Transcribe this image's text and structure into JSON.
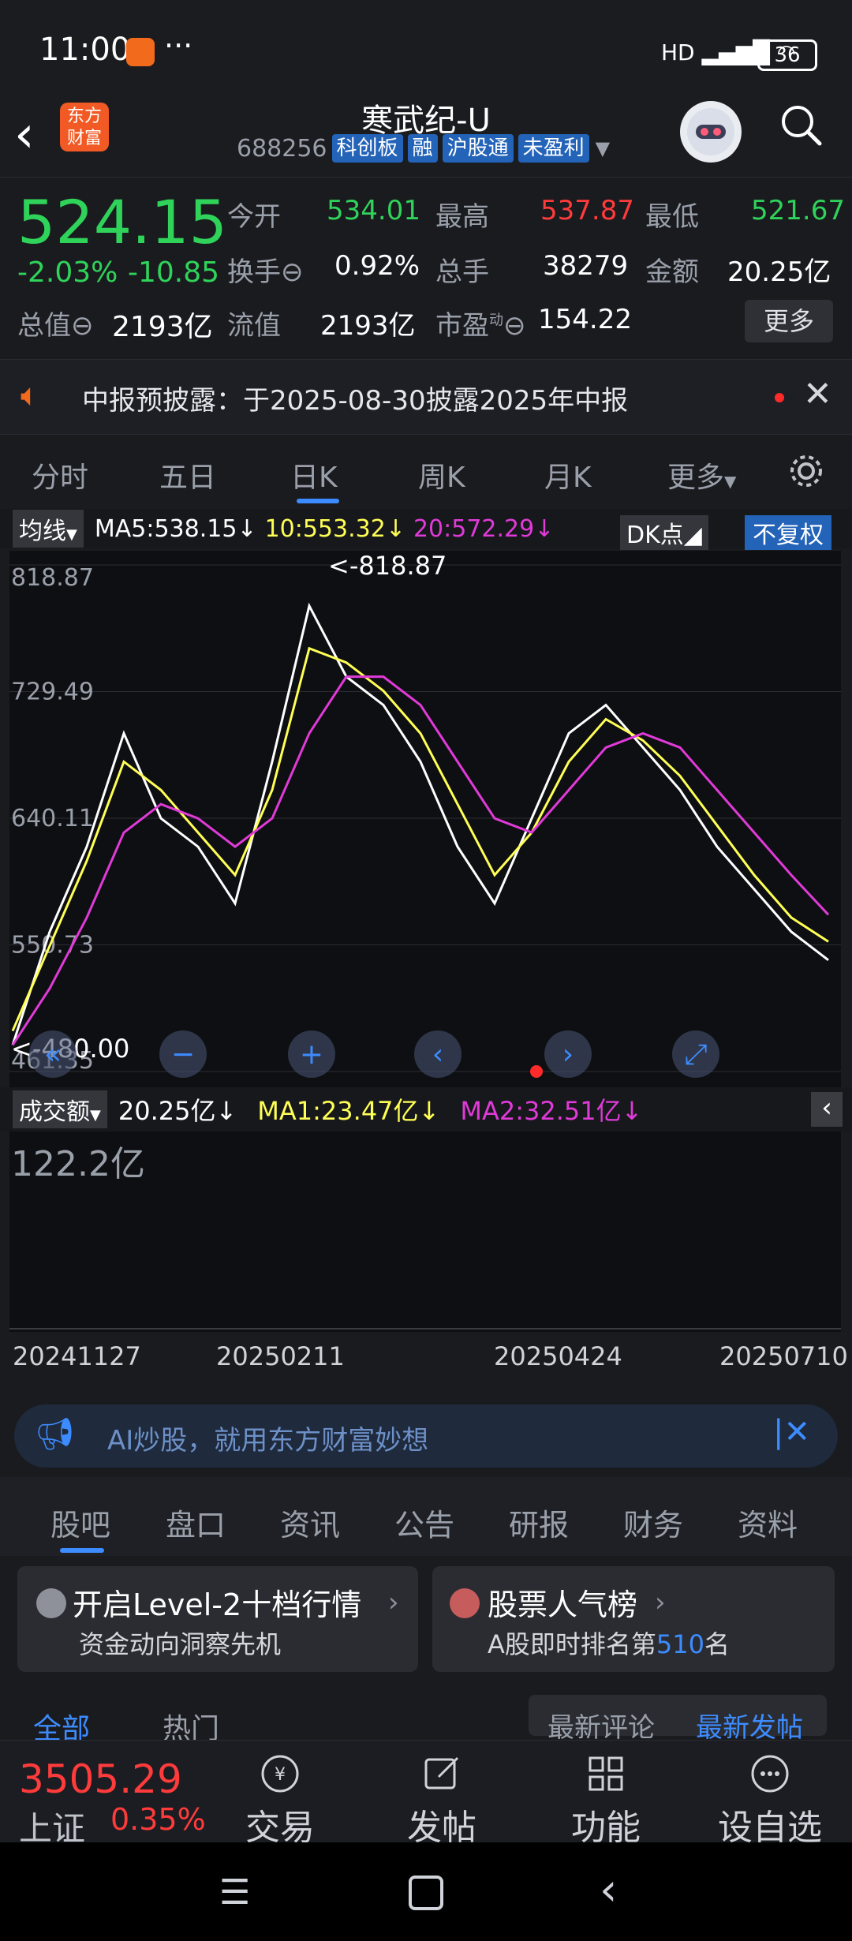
{
  "status": {
    "time": "11:00",
    "signal": "HD",
    "battery": "36"
  },
  "header": {
    "logo_text": "东方财富",
    "name": "寒武纪-U",
    "code": "688256",
    "tags": [
      "科创板",
      "融",
      "沪股通",
      "未盈利"
    ]
  },
  "quote": {
    "price": "524.15",
    "pct": "-2.03%",
    "change": "-10.85",
    "cap_label": "总值",
    "cap_value": "2193亿",
    "open_label": "今开",
    "open": "534.01",
    "high_label": "最高",
    "high": "537.87",
    "low_label": "最低",
    "low": "521.67",
    "turnover_label": "换手",
    "turnover": "0.92%",
    "volume_label": "总手",
    "volume": "38279",
    "amount_label": "金额",
    "amount": "20.25亿",
    "float_label": "流值",
    "float_value": "2193亿",
    "pe_label": "市盈",
    "pe_sup": "动",
    "pe": "154.22",
    "more": "更多"
  },
  "notice": {
    "text": "中报预披露：于2025-08-30披露2025年中报"
  },
  "ktabs": [
    "分时",
    "五日",
    "日K",
    "周K",
    "月K",
    "更多"
  ],
  "chart_bar": {
    "ma_select": "均线",
    "ma5": "MA5:538.15↓",
    "ma10": "10:553.32↓",
    "ma20": "20:572.29↓",
    "dk": "DK点",
    "adjust": "不复权"
  },
  "chart_data": {
    "type": "line",
    "x": [
      "20241127",
      "20250211",
      "20250424",
      "20250710"
    ],
    "ylim": [
      461.35,
      818.87
    ],
    "yticks": [
      "818.87",
      "729.49",
      "640.11",
      "550.73",
      "461.35"
    ],
    "high_marker": "<-818.87",
    "low_marker": "<-480.00",
    "series": [
      {
        "name": "MA5",
        "color": "#ffffff",
        "values": [
          480,
          560,
          620,
          700,
          640,
          620,
          580,
          680,
          790,
          740,
          720,
          680,
          620,
          580,
          640,
          700,
          720,
          690,
          660,
          620,
          590,
          560,
          540
        ]
      },
      {
        "name": "MA10",
        "color": "#ffff55",
        "values": [
          490,
          550,
          610,
          680,
          660,
          630,
          600,
          660,
          760,
          750,
          730,
          700,
          650,
          600,
          630,
          680,
          710,
          695,
          670,
          635,
          600,
          570,
          553
        ]
      },
      {
        "name": "MA20",
        "color": "#e03ad8",
        "values": [
          480,
          520,
          570,
          630,
          650,
          640,
          620,
          640,
          700,
          740,
          740,
          720,
          680,
          640,
          630,
          660,
          690,
          700,
          690,
          660,
          630,
          600,
          572
        ]
      }
    ]
  },
  "vol_bar": {
    "select": "成交额",
    "value": "20.25亿↓",
    "ma1": "MA1:23.47亿↓",
    "ma2": "MA2:32.51亿↓",
    "axis_top": "122.2亿"
  },
  "ai_banner": {
    "text": "AI炒股，就用东方财富妙想"
  },
  "sec_tabs": [
    "股吧",
    "盘口",
    "资讯",
    "公告",
    "研报",
    "财务",
    "资料"
  ],
  "cards": [
    {
      "title": "开启Level-2十档行情",
      "sub": "资金动向洞察先机"
    },
    {
      "title": "股票人气榜",
      "sub_prefix": "A股即时排名第",
      "sub_rank": "510",
      "sub_suffix": "名"
    }
  ],
  "feed_tabs": [
    "全部",
    "热门",
    "最新评论",
    "最新发帖"
  ],
  "bottom_nav": {
    "index_value": "3505.29",
    "index_name": "上证",
    "index_pct": "0.35%",
    "items": [
      "交易",
      "发帖",
      "功能",
      "设自选"
    ]
  }
}
